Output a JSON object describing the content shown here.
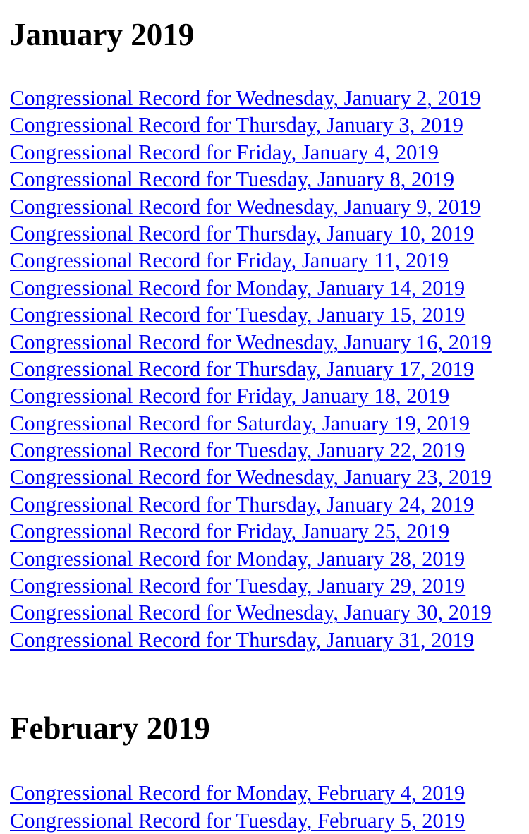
{
  "sections": [
    {
      "heading": "January 2019",
      "links": [
        "Congressional Record for Wednesday, January 2, 2019",
        "Congressional Record for Thursday, January 3, 2019",
        "Congressional Record for Friday, January 4, 2019",
        "Congressional Record for Tuesday, January 8, 2019",
        "Congressional Record for Wednesday, January 9, 2019",
        "Congressional Record for Thursday, January 10, 2019",
        "Congressional Record for Friday, January 11, 2019",
        "Congressional Record for Monday, January 14, 2019",
        "Congressional Record for Tuesday, January 15, 2019",
        "Congressional Record for Wednesday, January 16, 2019",
        "Congressional Record for Thursday, January 17, 2019",
        "Congressional Record for Friday, January 18, 2019",
        "Congressional Record for Saturday, January 19, 2019",
        "Congressional Record for Tuesday, January 22, 2019",
        "Congressional Record for Wednesday, January 23, 2019",
        "Congressional Record for Thursday, January 24, 2019",
        "Congressional Record for Friday, January 25, 2019",
        "Congressional Record for Monday, January 28, 2019",
        "Congressional Record for Tuesday, January 29, 2019",
        "Congressional Record for Wednesday, January 30, 2019",
        "Congressional Record for Thursday, January 31, 2019"
      ]
    },
    {
      "heading": "February 2019",
      "links": [
        "Congressional Record for Monday, February 4, 2019",
        "Congressional Record for Tuesday, February 5, 2019"
      ]
    }
  ],
  "colors": {
    "link": "#0000ee",
    "text": "#000000",
    "background": "#ffffff"
  }
}
